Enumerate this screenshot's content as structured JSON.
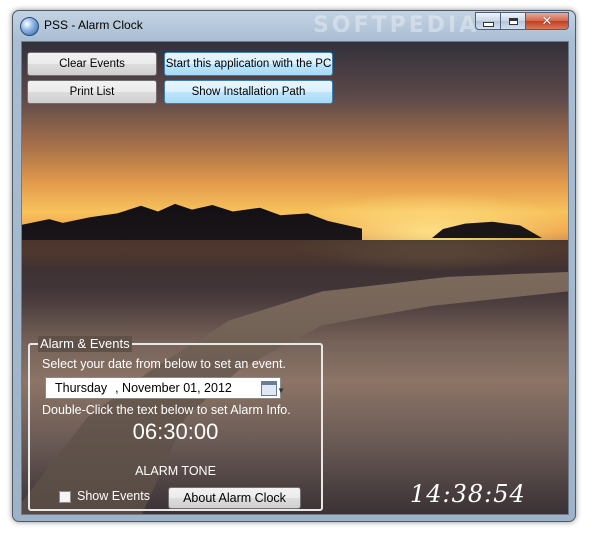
{
  "window": {
    "title": "PSS - Alarm Clock",
    "watermark": "SOFTPEDIA",
    "caption_close": "✕"
  },
  "toolbar": {
    "clear_events": "Clear Events",
    "start_with_pc": "Start this application with the PC",
    "print_list": "Print List",
    "show_install_path": "Show Installation Path"
  },
  "alarm_group": {
    "legend": "Alarm & Events",
    "select_date_hint": "Select your date from below to set an event.",
    "date_day": "Thursday",
    "date_rest": ", November 01, 2012",
    "double_click_hint": "Double-Click the text below to set Alarm Info.",
    "alarm_time": "06:30:00",
    "alarm_tone": "ALARM TONE",
    "show_events_label": "Show Events",
    "show_events_checked": false,
    "about_button": "About Alarm Clock"
  },
  "clock": {
    "current_time": "14:38:54"
  },
  "colors": {
    "hot_button": "#bee6fd",
    "overlay_text": "#ffffff"
  }
}
